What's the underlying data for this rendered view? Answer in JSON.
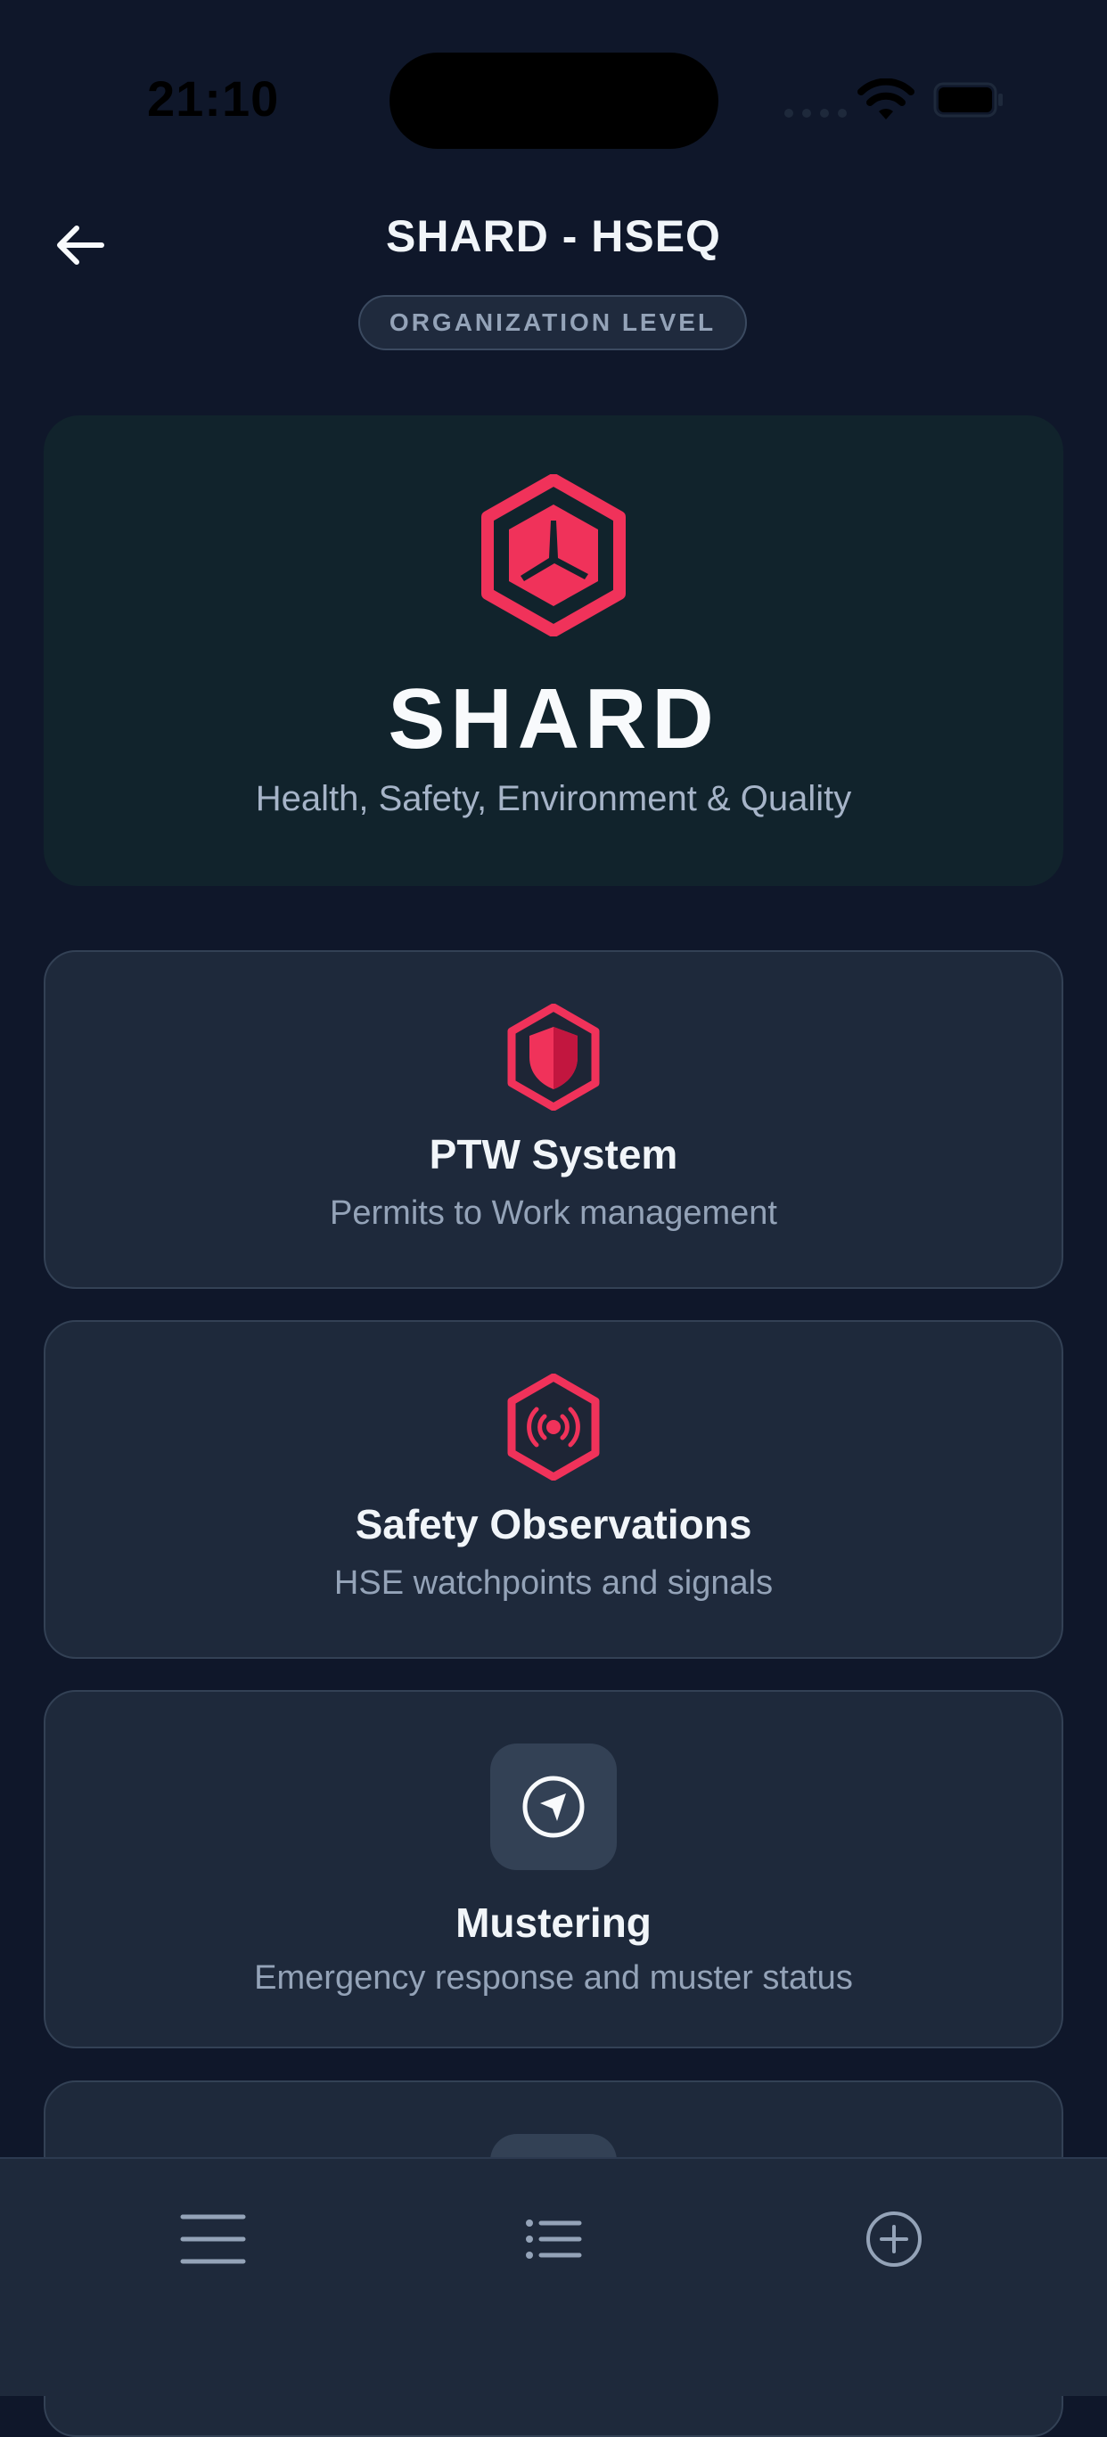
{
  "status_bar": {
    "time": "21:10"
  },
  "header": {
    "title": "SHARD - HSEQ",
    "badge": "ORGANIZATION LEVEL"
  },
  "hero": {
    "title": "SHARD",
    "subtitle": "Health, Safety, Environment & Quality"
  },
  "modules": [
    {
      "title": "PTW System",
      "subtitle": "Permits to Work management",
      "icon": "shield-hexagon-icon"
    },
    {
      "title": "Safety Observations",
      "subtitle": "HSE watchpoints and signals",
      "icon": "broadcast-hexagon-icon"
    },
    {
      "title": "Mustering",
      "subtitle": "Emergency response and muster status",
      "icon": "navigation-compass-icon"
    }
  ],
  "bottom_nav": {
    "items": [
      "menu-icon",
      "list-icon",
      "add-circle-icon"
    ]
  },
  "colors": {
    "background": "#0f172a",
    "card": "#1e293b",
    "hero": "#11232c",
    "accent": "#e11d48",
    "muted_text": "#94a3b8"
  }
}
